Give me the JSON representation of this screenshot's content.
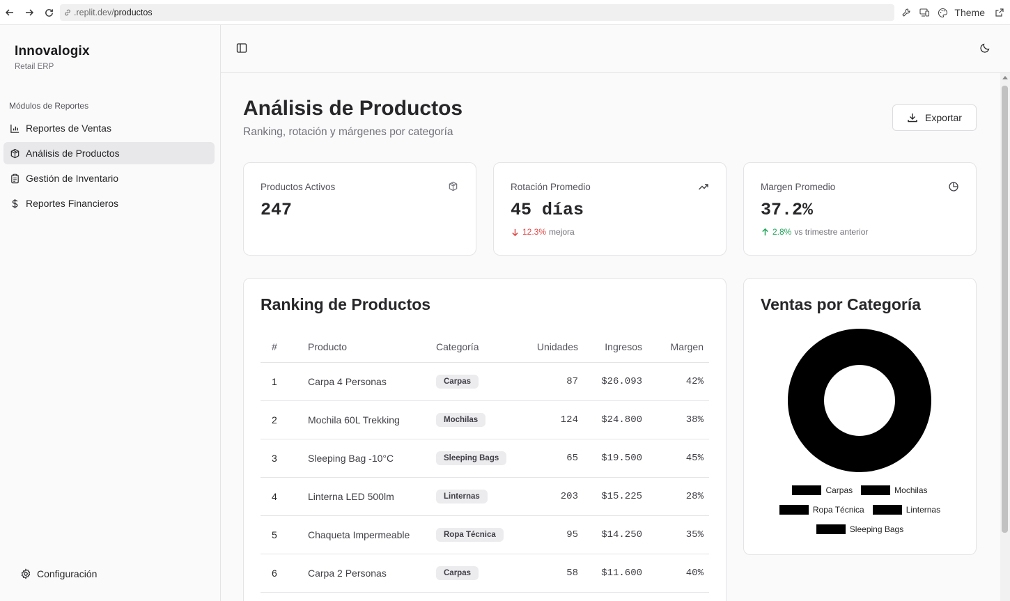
{
  "browser": {
    "url_domain": ".replit.dev/",
    "url_path": "productos",
    "theme_label": "Theme"
  },
  "sidebar": {
    "brand_name": "Innovalogix",
    "brand_sub": "Retail ERP",
    "section_label": "Módulos de Reportes",
    "items": [
      {
        "label": "Reportes de Ventas",
        "icon": "bar-chart-icon"
      },
      {
        "label": "Análisis de Productos",
        "icon": "package-icon",
        "active": true
      },
      {
        "label": "Gestión de Inventario",
        "icon": "clipboard-icon"
      },
      {
        "label": "Reportes Financieros",
        "icon": "dollar-icon"
      }
    ],
    "settings_label": "Configuración"
  },
  "page": {
    "title": "Análisis de Productos",
    "subtitle": "Ranking, rotación y márgenes por categoría",
    "export_label": "Exportar"
  },
  "kpis": [
    {
      "label": "Productos Activos",
      "value": "247",
      "icon": "package-icon"
    },
    {
      "label": "Rotación Promedio",
      "value": "45 días",
      "icon": "trending-up-icon",
      "delta": "12.3%",
      "delta_text": "mejora",
      "delta_dir": "down",
      "delta_color": "#e04a4a"
    },
    {
      "label": "Margen Promedio",
      "value": "37.2%",
      "icon": "pie-chart-icon",
      "delta": "2.8%",
      "delta_text": "vs trimestre anterior",
      "delta_dir": "up",
      "delta_color": "#22a55b"
    }
  ],
  "ranking": {
    "title": "Ranking de Productos",
    "columns": [
      "#",
      "Producto",
      "Categoría",
      "Unidades",
      "Ingresos",
      "Margen"
    ],
    "rows": [
      {
        "rank": "1",
        "product": "Carpa 4 Personas",
        "category": "Carpas",
        "units": "87",
        "revenue": "$26.093",
        "margin": "42%",
        "margin_color": "green"
      },
      {
        "rank": "2",
        "product": "Mochila 60L Trekking",
        "category": "Mochilas",
        "units": "124",
        "revenue": "$24.800",
        "margin": "38%",
        "margin_color": "orange"
      },
      {
        "rank": "3",
        "product": "Sleeping Bag -10°C",
        "category": "Sleeping Bags",
        "units": "65",
        "revenue": "$19.500",
        "margin": "45%",
        "margin_color": "green"
      },
      {
        "rank": "4",
        "product": "Linterna LED 500lm",
        "category": "Linternas",
        "units": "203",
        "revenue": "$15.225",
        "margin": "28%",
        "margin_color": "orange"
      },
      {
        "rank": "5",
        "product": "Chaqueta Impermeable",
        "category": "Ropa Técnica",
        "units": "95",
        "revenue": "$14.250",
        "margin": "35%",
        "margin_color": "orange"
      },
      {
        "rank": "6",
        "product": "Carpa 2 Personas",
        "category": "Carpas",
        "units": "58",
        "revenue": "$11.600",
        "margin": "40%",
        "margin_color": "green"
      }
    ]
  },
  "category_chart": {
    "title": "Ventas por Categoría",
    "legend": [
      "Carpas",
      "Mochilas",
      "Ropa Técnica",
      "Linternas",
      "Sleeping Bags"
    ],
    "fill_color": "#000000"
  }
}
